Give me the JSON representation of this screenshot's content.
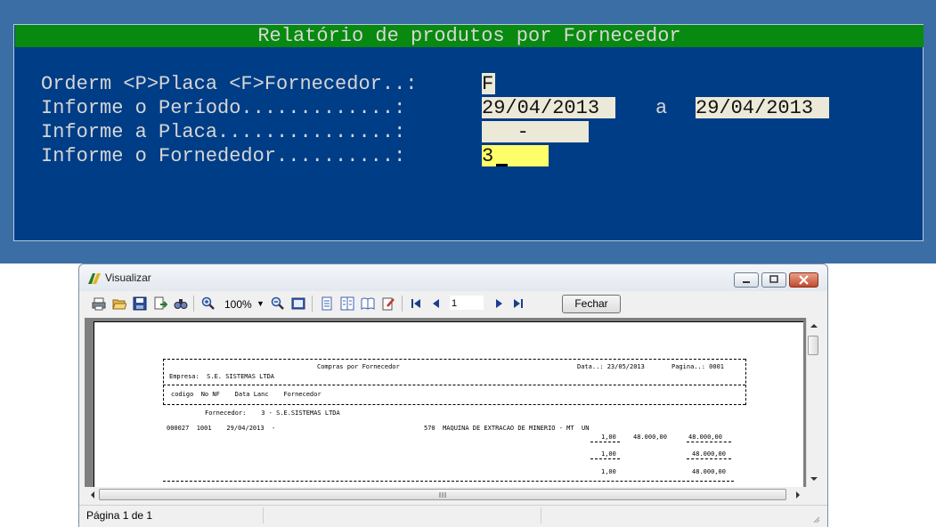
{
  "terminal": {
    "title": "Relatório de produtos por Fornecedor",
    "prompts": [
      "Orderm <P>Placa <F>Fornecedor..:",
      "Informe o Período.............:",
      "Informe a Placa...............:",
      "Informe o Fornededor..........:"
    ],
    "order_value": "F",
    "period_start": "29/04/2013",
    "period_sep": "a",
    "period_end": "29/04/2013",
    "plate_value": "   -",
    "supplier_value": "3"
  },
  "viewer": {
    "title": "Visualizar",
    "zoom": "100%",
    "page_number": "1",
    "close_label": "Fechar",
    "status": "Página 1 de 1",
    "icons": [
      "print-icon",
      "open-icon",
      "save-icon",
      "export-icon",
      "find-icon",
      "zoom-in-icon",
      "zoom-out-icon",
      "page-width-icon",
      "single-page-icon",
      "two-pages-icon",
      "book-icon",
      "edit-icon",
      "first-page-icon",
      "prev-page-icon",
      "next-page-icon",
      "last-page-icon"
    ]
  },
  "report": {
    "title": "Compras por Fornecedor",
    "date": "Data..: 23/05/2013",
    "page": "Pagina..: 0001",
    "company": "Empresa:  S.E. SISTEMAS LTDA",
    "columns": "codigo  No NF    Data Lanc    Fornecedor",
    "group": "Fornecedor:    3 - S.E.SISTEMAS LTDA",
    "line": "000027  1001    29/04/2013  -",
    "item": "570  MAQUINA DE EXTRACAO DE MINERIO - MT  UN",
    "qty": "1,00",
    "unit_price": "48.000,00",
    "total": "48.000,00",
    "subtotal_qty": "1,00",
    "subtotal_total": "48.000,00",
    "grand_qty": "1,00",
    "grand_total": "48.000,00"
  },
  "colors": {
    "desktop": "#3a6ea5",
    "terminal_bg": "#003d87",
    "title_bar": "#078a0f",
    "input_bg": "#ece9d8",
    "active_input": "#ffff6a"
  }
}
